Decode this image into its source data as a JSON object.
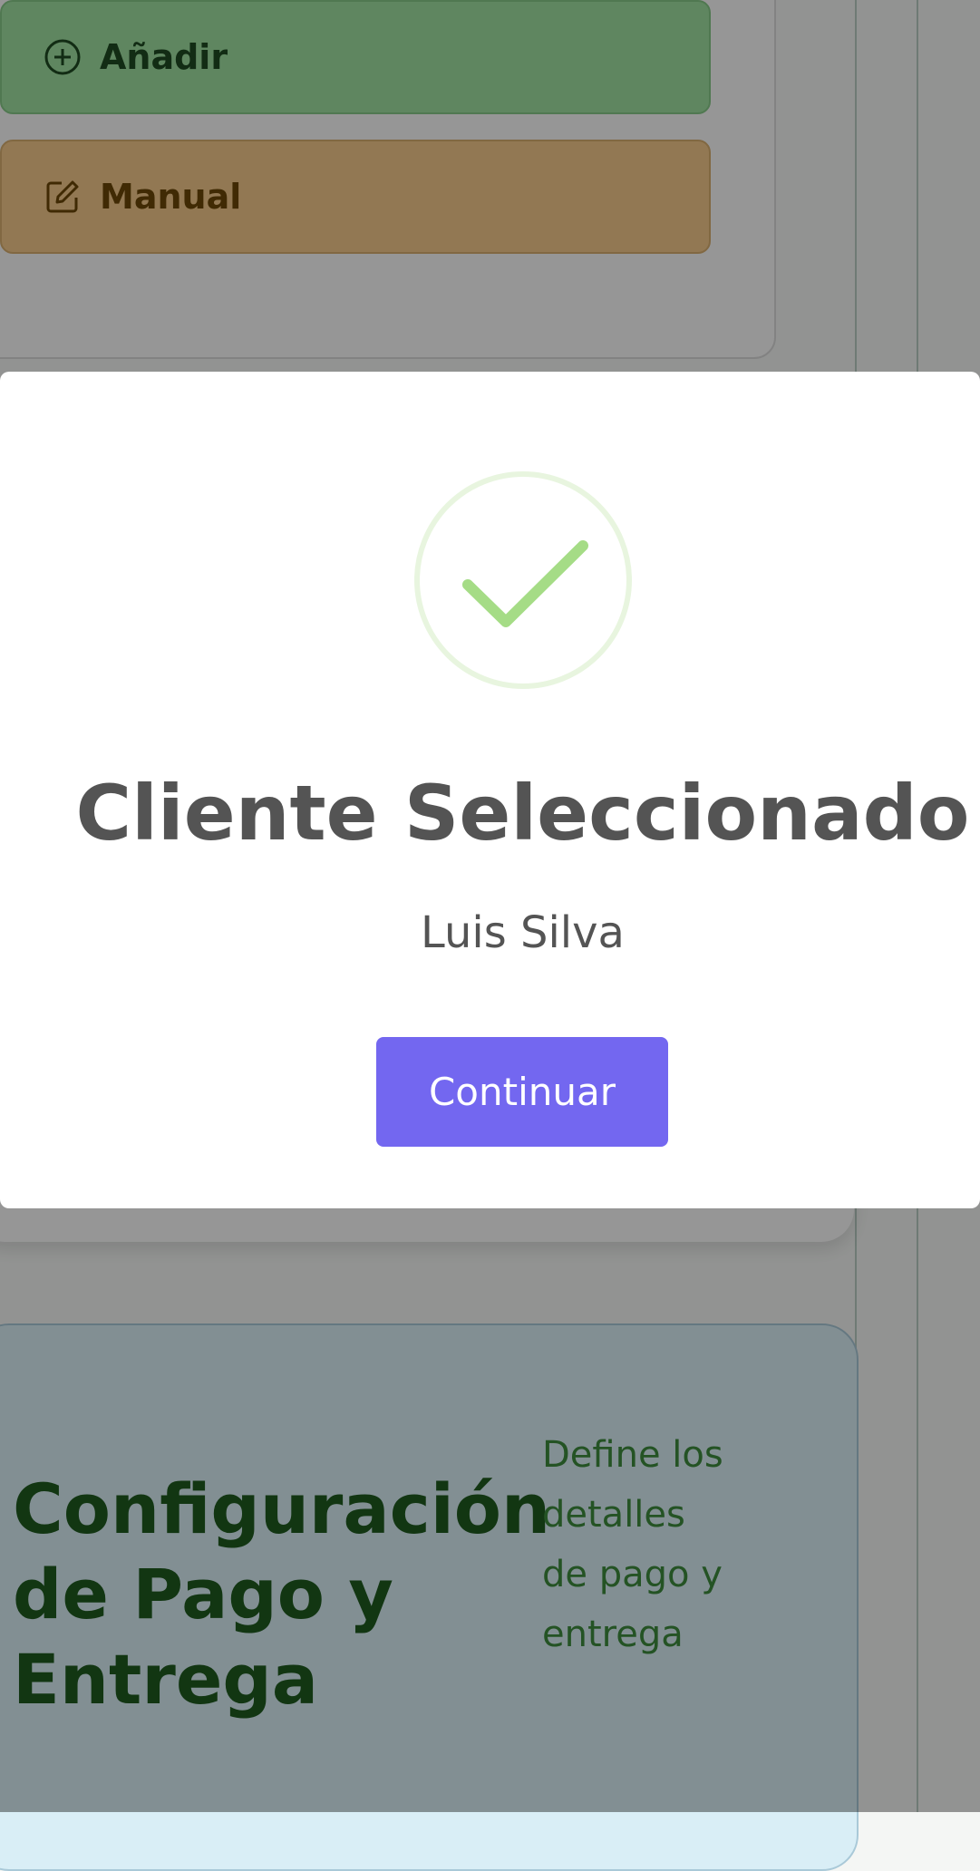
{
  "background": {
    "buttons": {
      "add_label": "Añadir",
      "manual_label": "Manual"
    },
    "config_section": {
      "title": "Configuración de Pago y Entrega",
      "description": "Define los detalles de pago y entrega"
    }
  },
  "modal": {
    "icon": "success-check-icon",
    "title": "Cliente Seleccionado",
    "client_name": "Luis Silva",
    "continue_label": "Continuar"
  },
  "colors": {
    "accent": "#7367f0",
    "success": "#a5dc86",
    "add_button": "#9fe0a0",
    "manual_button": "#f3c98a",
    "config_bg": "#d9eef6"
  }
}
